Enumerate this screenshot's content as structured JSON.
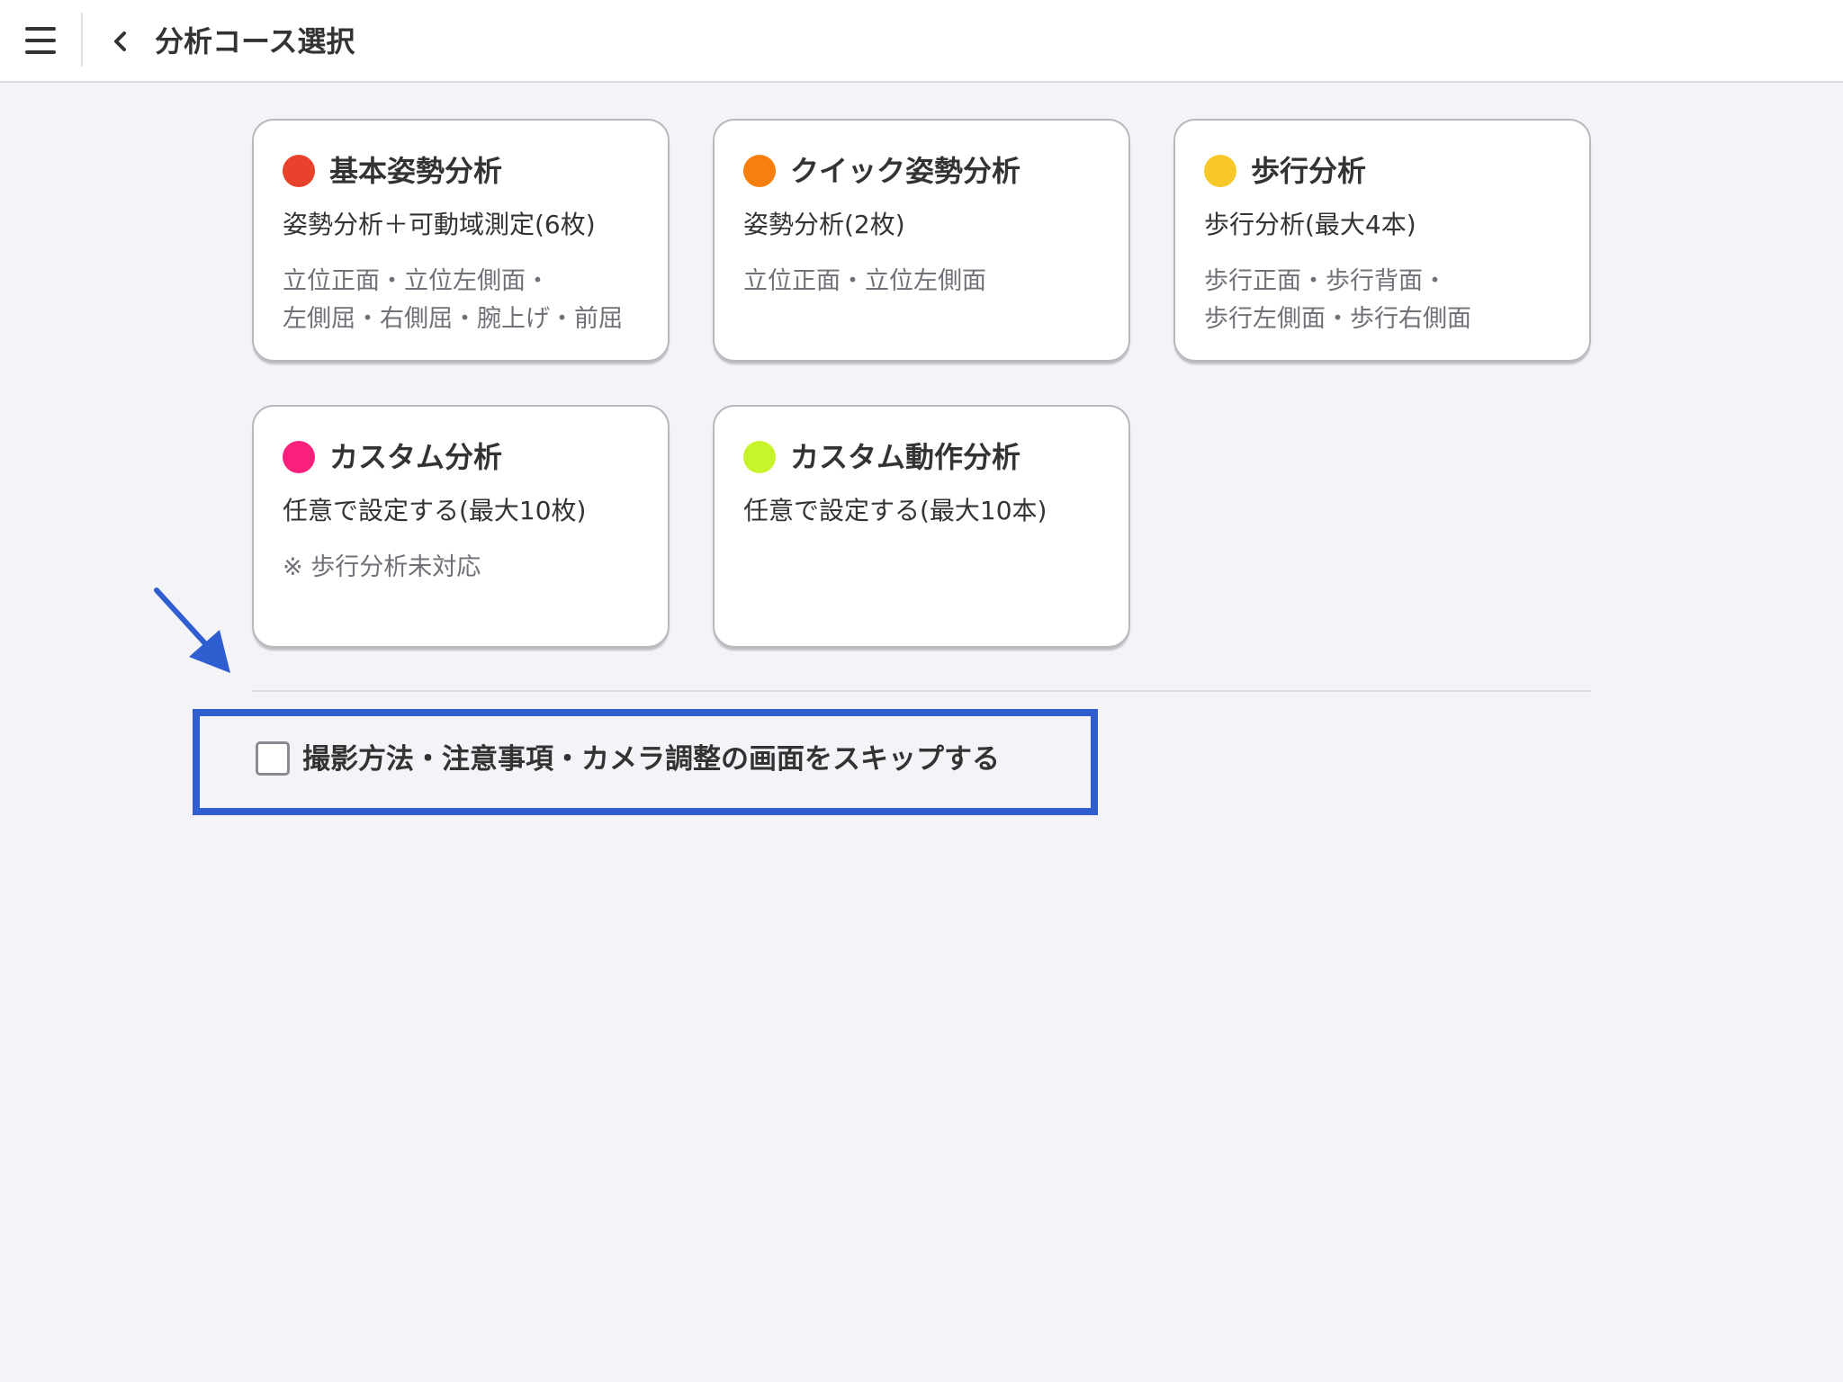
{
  "header": {
    "title": "分析コース選択",
    "menu_icon": "hamburger-menu-icon",
    "back_icon": "chevron-left-icon"
  },
  "courses": [
    {
      "title": "基本姿勢分析",
      "subtitle": "姿勢分析＋可動域測定(6枚)",
      "detail_lines": [
        "立位正面・立位左側面・",
        "左側屈・右側屈・腕上げ・前屈"
      ],
      "color": "#e8412c"
    },
    {
      "title": "クイック姿勢分析",
      "subtitle": "姿勢分析(2枚)",
      "detail_lines": [
        "立位正面・立位左側面",
        ""
      ],
      "color": "#f77f0e"
    },
    {
      "title": "歩行分析",
      "subtitle": "歩行分析(最大4本)",
      "detail_lines": [
        "歩行正面・歩行背面・",
        "歩行左側面・歩行右側面"
      ],
      "color": "#f8c72a"
    },
    {
      "title": "カスタム分析",
      "subtitle": "任意で設定する(最大10枚)",
      "detail_lines": [
        "※ 歩行分析未対応",
        ""
      ],
      "color": "#f8207a"
    },
    {
      "title": "カスタム動作分析",
      "subtitle": "任意で設定する(最大10本)",
      "detail_lines": [
        "",
        ""
      ],
      "color": "#c6f52c"
    }
  ],
  "skip_option": {
    "label": "撮影方法・注意事項・カメラ調整の画面をスキップする",
    "checked": false
  },
  "annotation": {
    "highlight_color": "#2f5ed0",
    "arrow_icon": "arrow-down-right-icon"
  }
}
